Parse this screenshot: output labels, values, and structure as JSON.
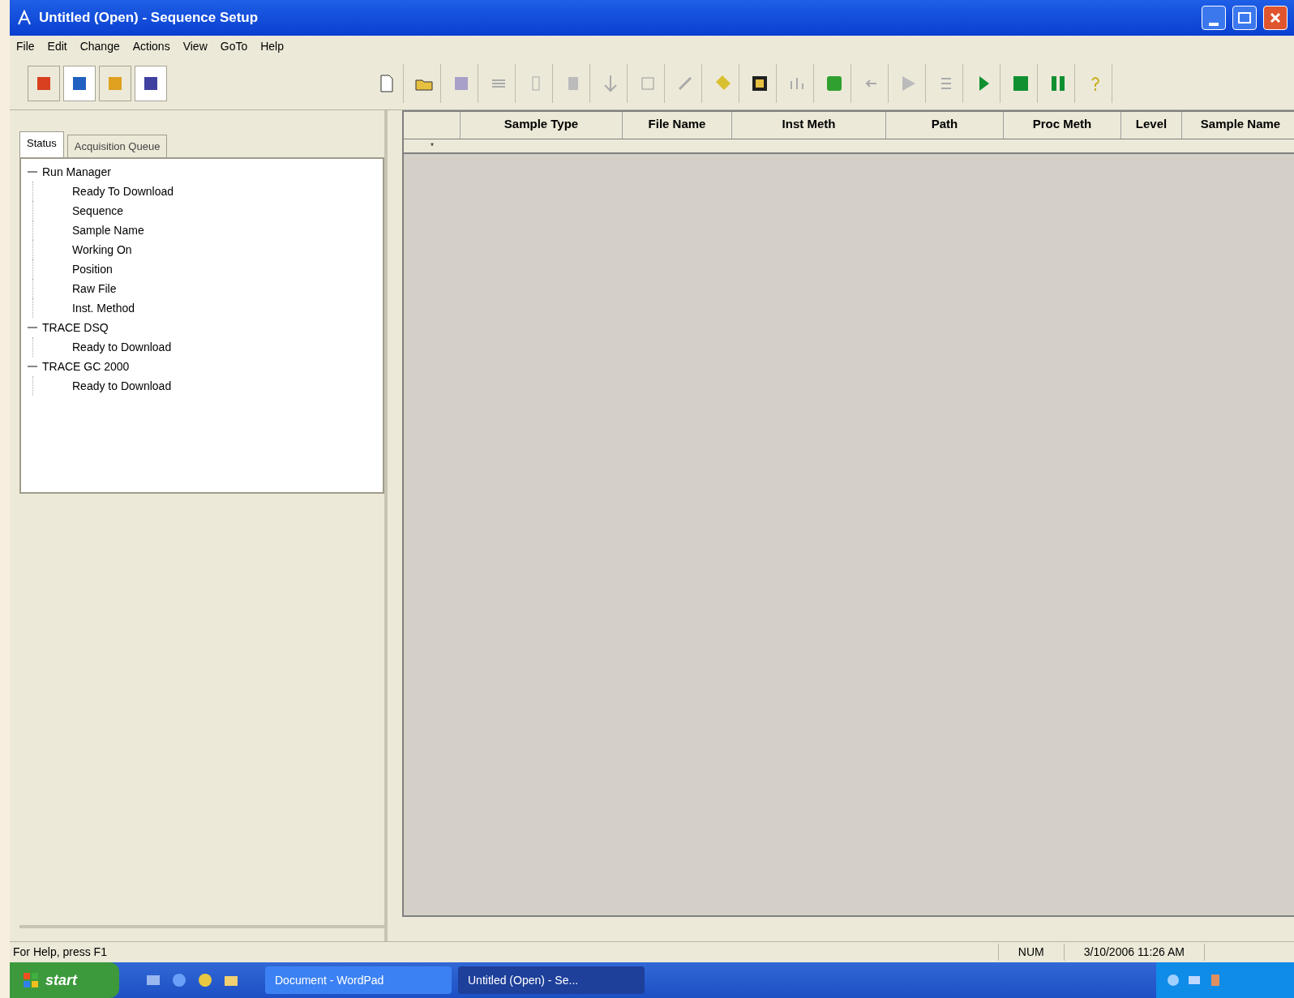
{
  "window": {
    "title": "Untitled (Open) - Sequence Setup"
  },
  "menu": [
    "File",
    "Edit",
    "Change",
    "Actions",
    "View",
    "GoTo",
    "Help"
  ],
  "tabs": [
    {
      "label": "Status",
      "selected": true
    },
    {
      "label": "Acquisition Queue",
      "selected": false
    }
  ],
  "tree": [
    {
      "label": "Run Manager",
      "expanded": true,
      "children": [
        {
          "label": "Ready To Download"
        },
        {
          "label": "Sequence"
        },
        {
          "label": "Sample Name"
        },
        {
          "label": "Working On"
        },
        {
          "label": "Position"
        },
        {
          "label": "Raw File"
        },
        {
          "label": "Inst. Method"
        }
      ]
    },
    {
      "label": "TRACE DSQ",
      "expanded": true,
      "children": [
        {
          "label": "Ready to Download"
        }
      ]
    },
    {
      "label": "TRACE GC 2000",
      "expanded": true,
      "children": [
        {
          "label": "Ready to Download"
        }
      ]
    }
  ],
  "table": {
    "columns": [
      "Sample Type",
      "File Name",
      "Inst Meth",
      "Path",
      "Proc Meth",
      "Level",
      "Sample Name"
    ],
    "new_row_marker": "*"
  },
  "status_bar": {
    "help": "For Help, press F1",
    "num": "NUM",
    "datetime": "3/10/2006 11:26 AM"
  },
  "taskbar": {
    "start": "start",
    "tasks": [
      {
        "label": "Document - WordPad",
        "selected": false
      },
      {
        "label": "Untitled (Open) - Se...",
        "selected": true
      }
    ]
  }
}
